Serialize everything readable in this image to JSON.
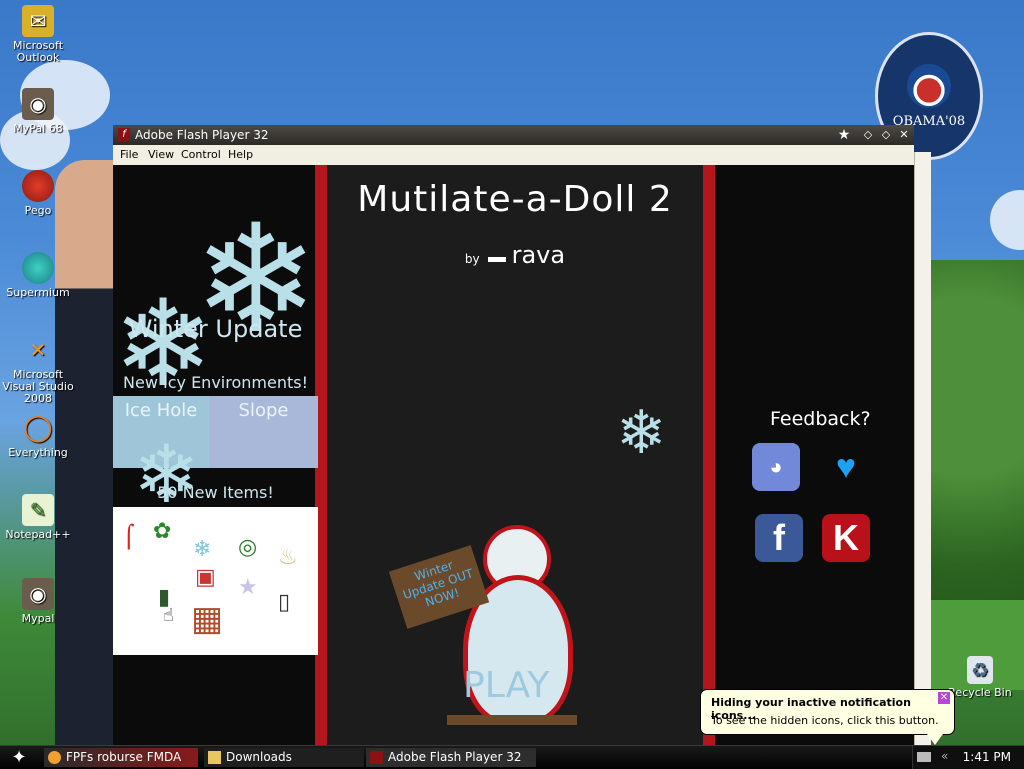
{
  "desktop": {
    "icons": [
      {
        "label": "Microsoft Outlook",
        "icon": "outlook-icon"
      },
      {
        "label": "MyPal 68",
        "icon": "raccoon-icon"
      },
      {
        "label": "Pego",
        "icon": "red-sphere-icon"
      },
      {
        "label": "Supermium",
        "icon": "supermium-icon"
      },
      {
        "label": "Microsoft Visual Studio 2008",
        "icon": "visual-studio-icon"
      },
      {
        "label": "Everything",
        "icon": "search-ring-icon"
      },
      {
        "label": "Notepad++",
        "icon": "notepad-icon"
      },
      {
        "label": "Mypal",
        "icon": "raccoon-icon"
      },
      {
        "label": "Recycle Bin",
        "icon": "recycle-bin-icon"
      }
    ],
    "badge_text": "OBAMA'08"
  },
  "window": {
    "title": "Adobe Flash Player 32",
    "menu": [
      "File",
      "View",
      "Control",
      "Help"
    ]
  },
  "game": {
    "title": "Mutilate-a-Doll 2",
    "by": "by",
    "author": "rava",
    "left": {
      "winter_update": "Winter Update",
      "new_env": "New Icy Environments!",
      "tile1": "Ice Hole",
      "tile2": "Slope",
      "new_items": "50 New Items!"
    },
    "sign_text": "Winter Update OUT NOW!",
    "play": "PLAY",
    "feedback": "Feedback?",
    "social": [
      "discord-icon",
      "twitter-icon",
      "facebook-icon",
      "kongregate-icon"
    ],
    "colors": {
      "red": "#b3171d",
      "panel": "#1c1c1c"
    }
  },
  "taskbar": {
    "tasks": [
      "FPFs roburse FMDA",
      "Downloads",
      "Adobe Flash Player 32"
    ],
    "clock": "1:41 PM"
  },
  "balloon": {
    "title": "Hiding your inactive notification icons...",
    "body": "To see the hidden icons, click this button."
  }
}
